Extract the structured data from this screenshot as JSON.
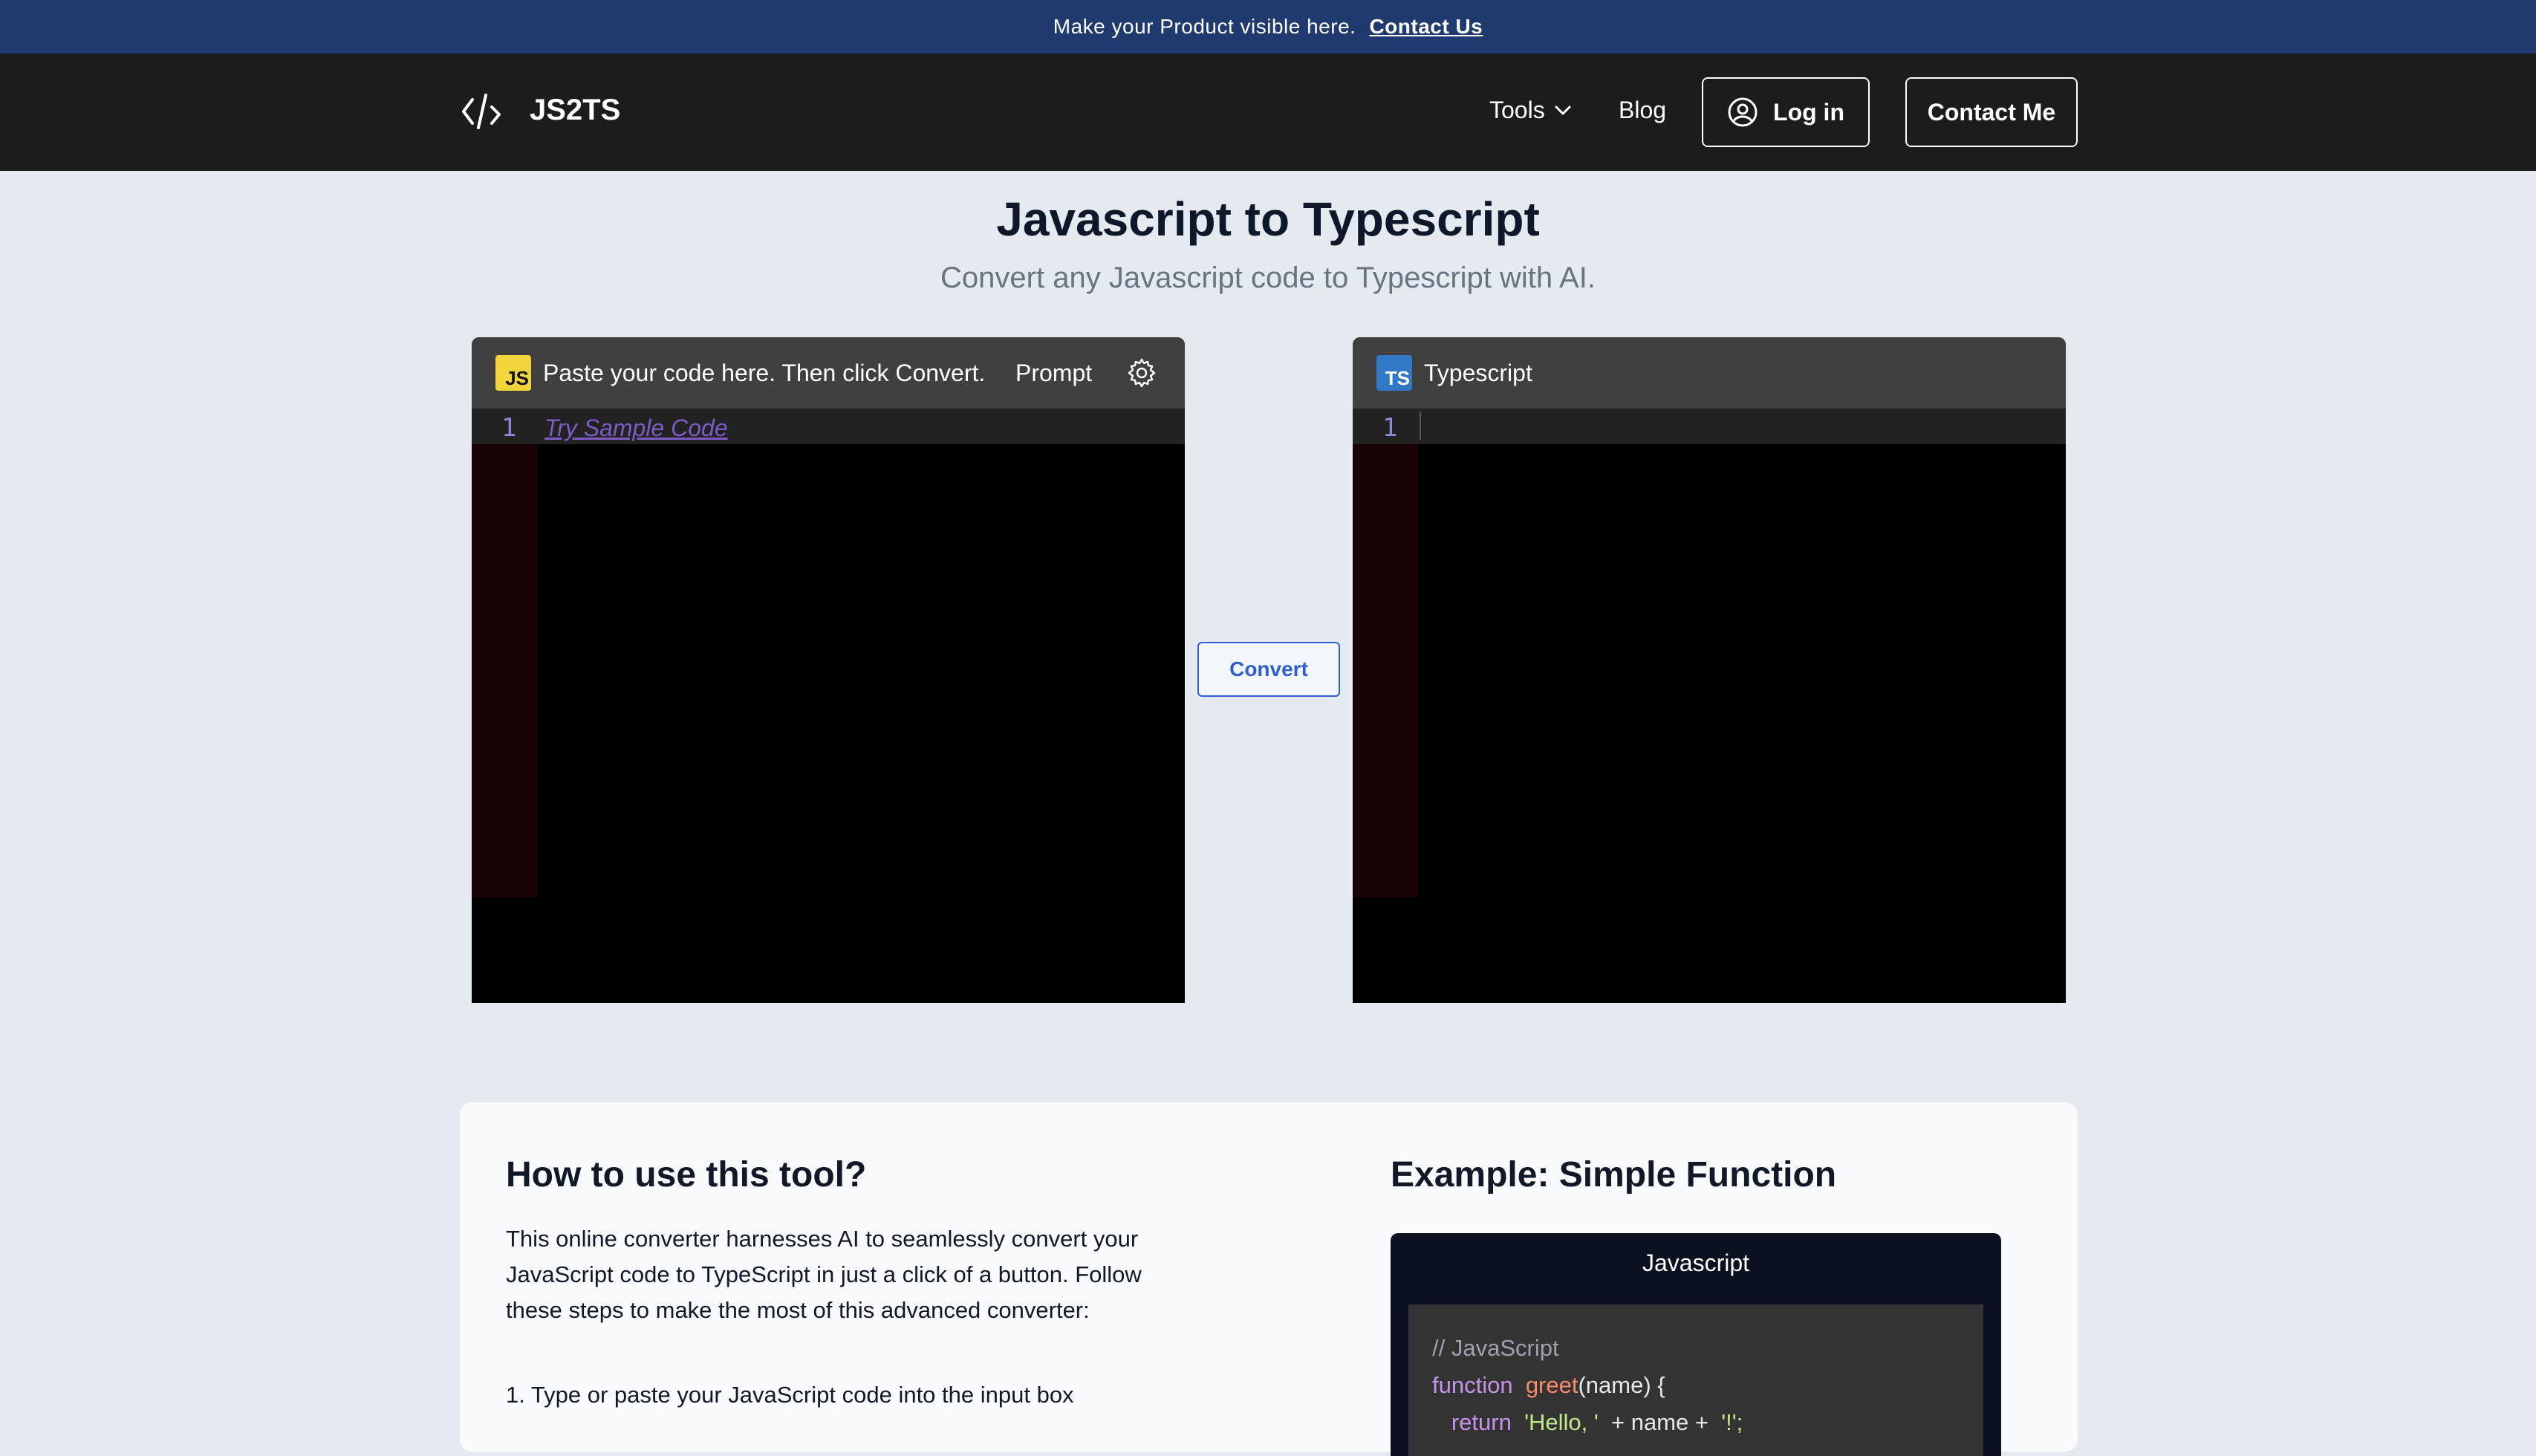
{
  "banner": {
    "text": "Make your Product visible here.",
    "cta": "Contact Us"
  },
  "nav": {
    "logo_icon": "code-brackets-icon",
    "brand": "JS2TS",
    "tools": "Tools",
    "blog": "Blog",
    "login": "Log in",
    "contact": "Contact Me"
  },
  "hero": {
    "title": "Javascript to Typescript",
    "subtitle": "Convert any Javascript code to Typescript with AI."
  },
  "input_editor": {
    "badge": "JS",
    "label": "Paste your code here. Then click Convert.",
    "prompt": "Prompt",
    "line_number": "1",
    "sample_link": "Try Sample Code"
  },
  "output_editor": {
    "badge": "TS",
    "label": "Typescript",
    "line_number": "1"
  },
  "convert_button": "Convert",
  "howto": {
    "title": "How to use this tool?",
    "paragraph": "This online converter harnesses AI to seamlessly convert your JavaScript code to TypeScript in just a click of a button. Follow these steps to make the most of this advanced converter:",
    "step1": "1. Type or paste your JavaScript code into the input box"
  },
  "example": {
    "title": "Example: Simple Function",
    "tab": "Javascript",
    "code": {
      "comment": "// JavaScript",
      "kw_function": "function",
      "fn_name": "greet",
      "params": "(name)  {",
      "kw_return": "return",
      "str_hello": "'Hello, '",
      "plus1": "+ name +",
      "str_end": "'!';"
    }
  },
  "colors": {
    "banner_bg": "#1e3a6e",
    "nav_bg": "#1c1c1c",
    "page_bg": "#e5e9f0",
    "accent": "#2f5fd0",
    "js_yellow": "#f2d53c",
    "ts_blue": "#3178c6"
  }
}
